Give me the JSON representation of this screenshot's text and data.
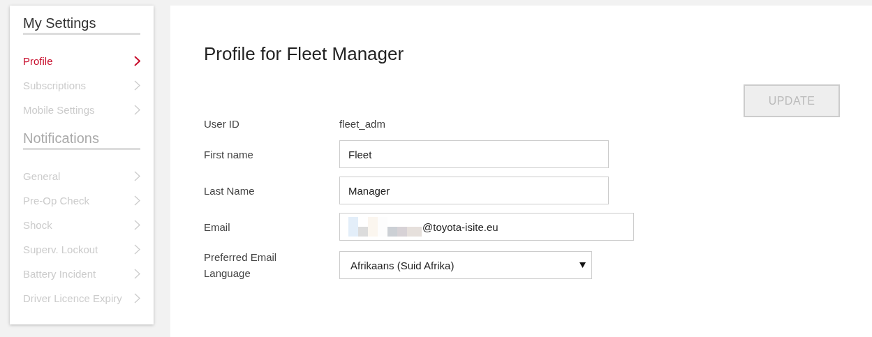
{
  "sidebar": {
    "sections": [
      {
        "title": "My Settings",
        "items": [
          {
            "label": "Profile",
            "selected": true
          },
          {
            "label": "Subscriptions",
            "selected": false
          },
          {
            "label": "Mobile Settings",
            "selected": false
          }
        ]
      },
      {
        "title": "Notifications",
        "items": [
          {
            "label": "General",
            "selected": false
          },
          {
            "label": "Pre-Op Check",
            "selected": false
          },
          {
            "label": "Shock",
            "selected": false
          },
          {
            "label": "Superv. Lockout",
            "selected": false
          },
          {
            "label": "Battery Incident",
            "selected": false
          },
          {
            "label": "Driver Licence Expiry",
            "selected": false
          }
        ]
      }
    ]
  },
  "main": {
    "title": "Profile for Fleet Manager",
    "update_button": {
      "label": "UPDATE",
      "disabled": true
    },
    "fields": [
      {
        "kind": "text",
        "label": "User ID",
        "value": "fleet_adm"
      },
      {
        "kind": "input",
        "label": "First name",
        "value": "Fleet"
      },
      {
        "kind": "input",
        "label": "Last Name",
        "value": "Manager"
      },
      {
        "kind": "redacted_input",
        "label": "Email",
        "value": "@toyota-isite.eu"
      },
      {
        "kind": "select",
        "label": "Preferred Email Language",
        "value": "Afrikaans (Suid Afrika)"
      }
    ]
  }
}
